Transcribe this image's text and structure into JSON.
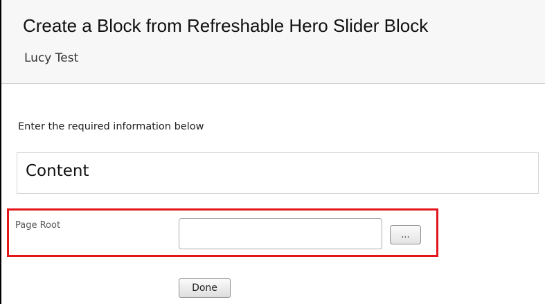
{
  "header": {
    "title": "Create a Block from Refreshable Hero Slider Block",
    "subtitle": "Lucy Test"
  },
  "form": {
    "instructions": "Enter the required information below",
    "section_title": "Content",
    "page_root": {
      "label": "Page Root",
      "value": "",
      "placeholder": "",
      "browse_label": "..."
    },
    "done_label": "Done"
  },
  "colors": {
    "highlight_border": "#e3151a",
    "header_background": "#f7f7f7"
  }
}
